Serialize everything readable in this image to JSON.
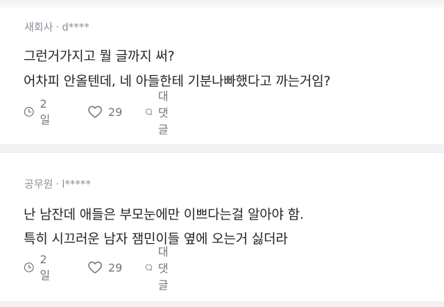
{
  "comments": [
    {
      "company": "새회사",
      "separator": "·",
      "user": "d****",
      "lines": [
        "그런거가지고 뭘 글까지 써?",
        "어차피 안올텐데, 네 아들한테 기분나빠했다고 까는거임?"
      ],
      "time": "2일",
      "likes": "29",
      "reply_label": "대댓글"
    },
    {
      "company": "공무원",
      "separator": "·",
      "user": "l*****",
      "lines": [
        "난 남잔데 애들은 부모눈에만 이쁘다는걸 알아야 함.",
        "특히 시끄러운 남자 잼민이들 옆에 오는거 싫더라"
      ],
      "time": "2일",
      "likes": "29",
      "reply_label": "대댓글"
    }
  ],
  "icons": {
    "time": "clock-icon",
    "like": "heart-icon",
    "reply": "speech-bubble-icon"
  },
  "colors": {
    "meta_text": "#8a8f99",
    "body_text": "#222326",
    "action_text": "#6f747c",
    "divider": "#f2f3f5"
  }
}
